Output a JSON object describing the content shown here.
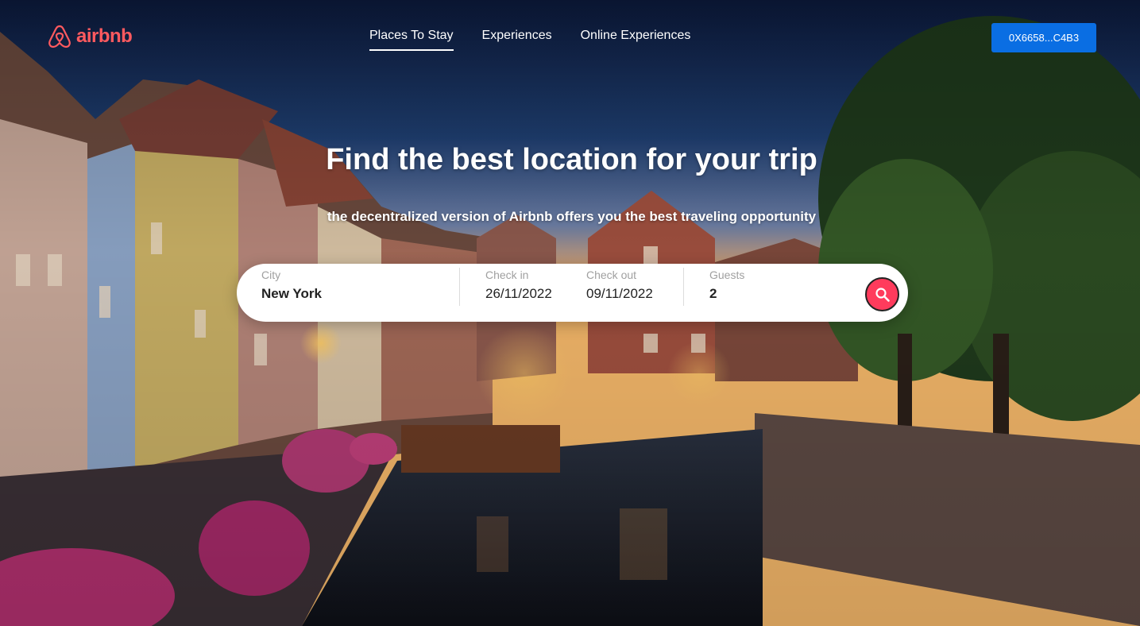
{
  "header": {
    "logo_text": "airbnb",
    "nav": [
      {
        "label": "Places To Stay",
        "active": true
      },
      {
        "label": "Experiences",
        "active": false
      },
      {
        "label": "Online Experiences",
        "active": false
      }
    ],
    "wallet_label": "0X6658...C4B3"
  },
  "hero": {
    "title": "Find the best location for your trip",
    "subtitle": "the decentralized version of Airbnb offers you the best traveling opportunity"
  },
  "search": {
    "city_label": "City",
    "city_value": "New York",
    "checkin_label": "Check in",
    "checkin_value": "26/11/2022",
    "checkout_label": "Check out",
    "checkout_value": "09/11/2022",
    "guests_label": "Guests",
    "guests_value": "2",
    "button_icon": "search-icon"
  },
  "colors": {
    "brand": "#ff5a5f",
    "search_button": "#ff3b5c",
    "wallet_button": "#0a6ee3",
    "text_light": "#ffffff"
  }
}
